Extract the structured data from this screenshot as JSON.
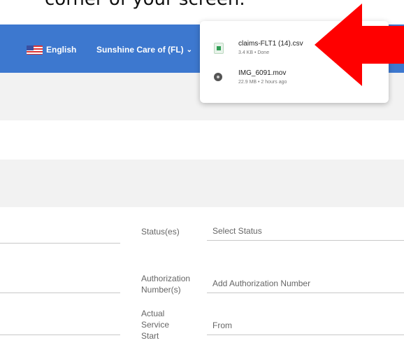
{
  "caption": "corner of your screen.",
  "header": {
    "language_label": "English",
    "org_label": "Sunshine Care of (FL)"
  },
  "downloads": [
    {
      "name": "claims-FLT1 (14).csv",
      "meta": "3.4 KB • Done",
      "icon": "csv-file-icon"
    },
    {
      "name": "IMG_6091.mov",
      "meta": "22.9 MB • 2 hours ago",
      "icon": "video-file-icon"
    }
  ],
  "form": {
    "status_label": "Status(es)",
    "status_placeholder": "Select Status",
    "auth_label": "Authorization Number(s)",
    "auth_placeholder": "Add Authorization Number",
    "service_label": "Actual Service Start",
    "service_placeholder": "From"
  },
  "colors": {
    "navbar": "#3d78cf",
    "arrow": "#ff0000",
    "band": "#f2f2f2"
  }
}
